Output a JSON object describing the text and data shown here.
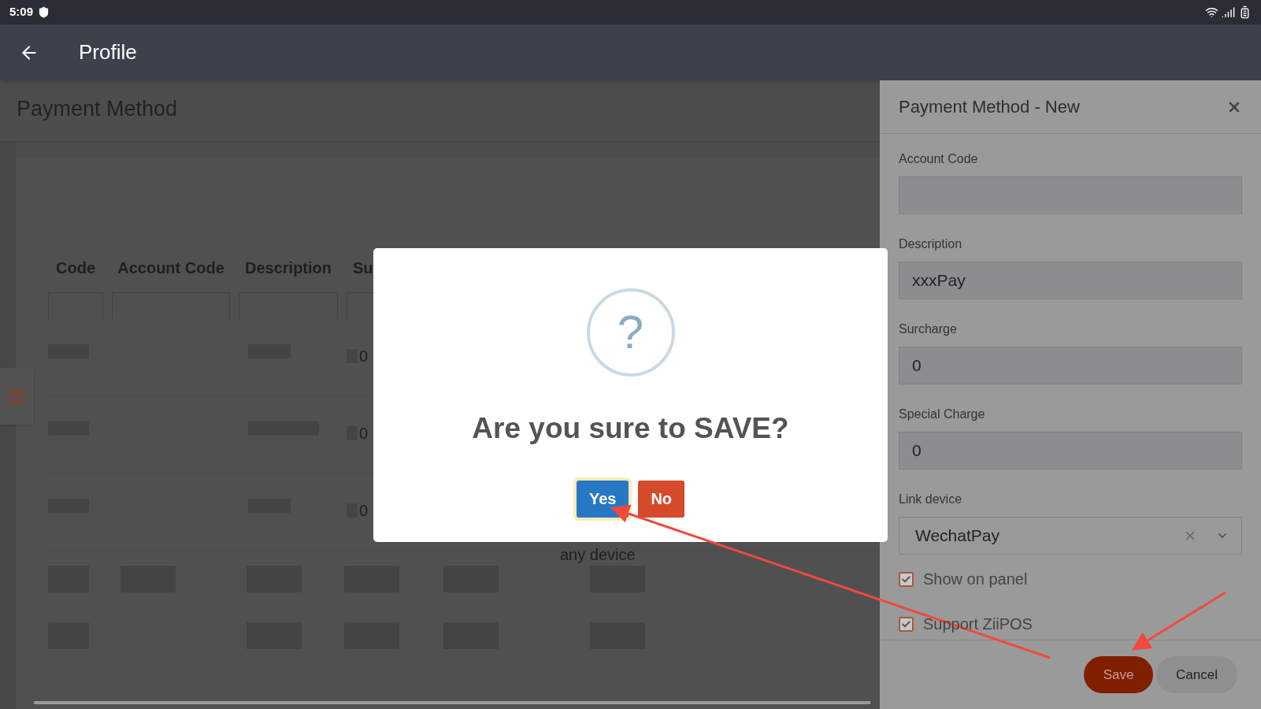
{
  "status_bar": {
    "time": "5:09"
  },
  "app_bar": {
    "title": "Profile"
  },
  "page": {
    "title": "Payment Method",
    "table": {
      "columns": [
        "Code",
        "Account Code",
        "Description",
        "Su"
      ],
      "rows": [
        {
          "column_4": "0"
        },
        {
          "column_4": "0"
        },
        {
          "column_4": "0",
          "column_6": "any device"
        }
      ]
    }
  },
  "dialog": {
    "icon": "?",
    "message": "Are you sure to SAVE?",
    "buttons": [
      {
        "label": "Yes",
        "kind": "confirm",
        "focused": true
      },
      {
        "label": "No",
        "kind": "cancel",
        "focused": false
      }
    ]
  },
  "side_panel": {
    "title": "Payment Method - New",
    "fields": [
      {
        "label": "Account Code",
        "kind": "text"
      },
      {
        "label": "Description",
        "kind": "text",
        "value": "xxxPay"
      },
      {
        "label": "Surcharge",
        "kind": "text",
        "value": "0"
      },
      {
        "label": "Special Charge",
        "kind": "text",
        "value": "0"
      },
      {
        "label": "Link device",
        "kind": "select",
        "value": "WechatPay"
      }
    ],
    "checkboxes": [
      {
        "label": "Show on panel",
        "checked": true
      },
      {
        "label": "Support ZiiPOS",
        "checked": true
      }
    ],
    "buttons": [
      {
        "label": "Save",
        "kind": "primary"
      },
      {
        "label": "Cancel",
        "kind": "secondary"
      }
    ]
  }
}
